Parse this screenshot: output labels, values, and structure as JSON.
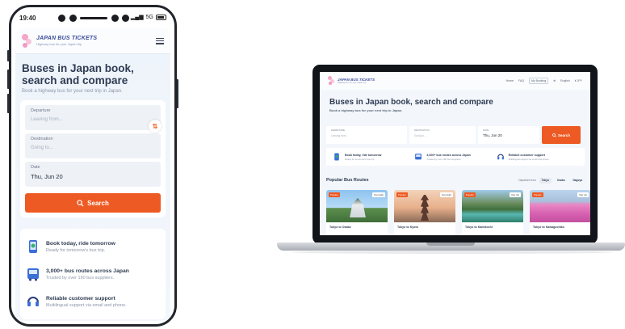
{
  "phone": {
    "status": {
      "time": "19:40",
      "network": "5G"
    },
    "logo": {
      "title": "JAPAN BUS TICKETS",
      "tagline": "Highway bus for your Japan trip"
    },
    "hero": {
      "title": "Buses in Japan book, search and compare",
      "subtitle": "Book a highway bus for your next trip in Japan."
    },
    "form": {
      "departure_label": "Departure",
      "departure_placeholder": "Leaving from...",
      "destination_label": "Destination",
      "destination_placeholder": "Going to...",
      "date_label": "Date",
      "date_value": "Thu, Jun 20",
      "search_label": "Search"
    },
    "features": [
      {
        "title": "Book today, ride tomorrow",
        "subtitle": "Ready for tomorrow's bus trip."
      },
      {
        "title": "3,000+ bus routes across Japan",
        "subtitle": "Trusted by over 160 bus suppliers."
      },
      {
        "title": "Reliable customer support",
        "subtitle": "Multilingual support via email and phone."
      }
    ]
  },
  "laptop": {
    "logo": {
      "title": "JAPAN BUS TICKETS",
      "tagline": "Highway bus for your Japan trip"
    },
    "nav": {
      "home": "Home",
      "faq": "FAQ",
      "my_booking": "My Booking",
      "language": "English",
      "currency": "¥ JPY"
    },
    "hero": {
      "title": "Buses in Japan book, search and compare",
      "subtitle": "Book a highway bus for your next trip in Japan."
    },
    "form": {
      "departure_label": "DEPARTURE",
      "departure_placeholder": "Leaving from...",
      "destination_label": "DESTINATION",
      "destination_placeholder": "Going to...",
      "date_label": "DATE",
      "date_value": "Thu, Jun 20",
      "search_label": "Search"
    },
    "features": [
      {
        "title": "Book today, ride tomorrow",
        "subtitle": "Ready for tomorrow's bus trip."
      },
      {
        "title": "3,000+ bus routes across Japan",
        "subtitle": "Trusted by over 160 bus suppliers."
      },
      {
        "title": "Reliable customer support",
        "subtitle": "Multilingual support via email and phone."
      }
    ],
    "popular": {
      "title": "Popular Bus Routes",
      "filter_label": "Departure from",
      "cities": [
        "Tokyo",
        "Osaka",
        "Nagoya"
      ],
      "active_city": "Tokyo"
    },
    "routes": [
      {
        "name": "Tokyo to Osaka",
        "badge": "Popular",
        "tag": "Overnight"
      },
      {
        "name": "Tokyo to Kyoto",
        "badge": "Popular",
        "tag": "Overnight"
      },
      {
        "name": "Tokyo to Kamikochi",
        "badge": "Popular",
        "tag": "Day trip"
      },
      {
        "name": "Tokyo to Kawaguchiko",
        "badge": "Popular",
        "tag": "Day trip"
      }
    ]
  },
  "colors": {
    "accent": "#ee5a24",
    "brand": "#3a4c9a",
    "heading": "#2e3b52",
    "background": "#f3f7fc"
  },
  "icons": [
    "signal-icon",
    "battery-icon",
    "menu-icon",
    "swap-icon",
    "search-icon",
    "ticket-phone-icon",
    "bus-icon",
    "headset-icon",
    "globe-icon",
    "user-icon"
  ]
}
